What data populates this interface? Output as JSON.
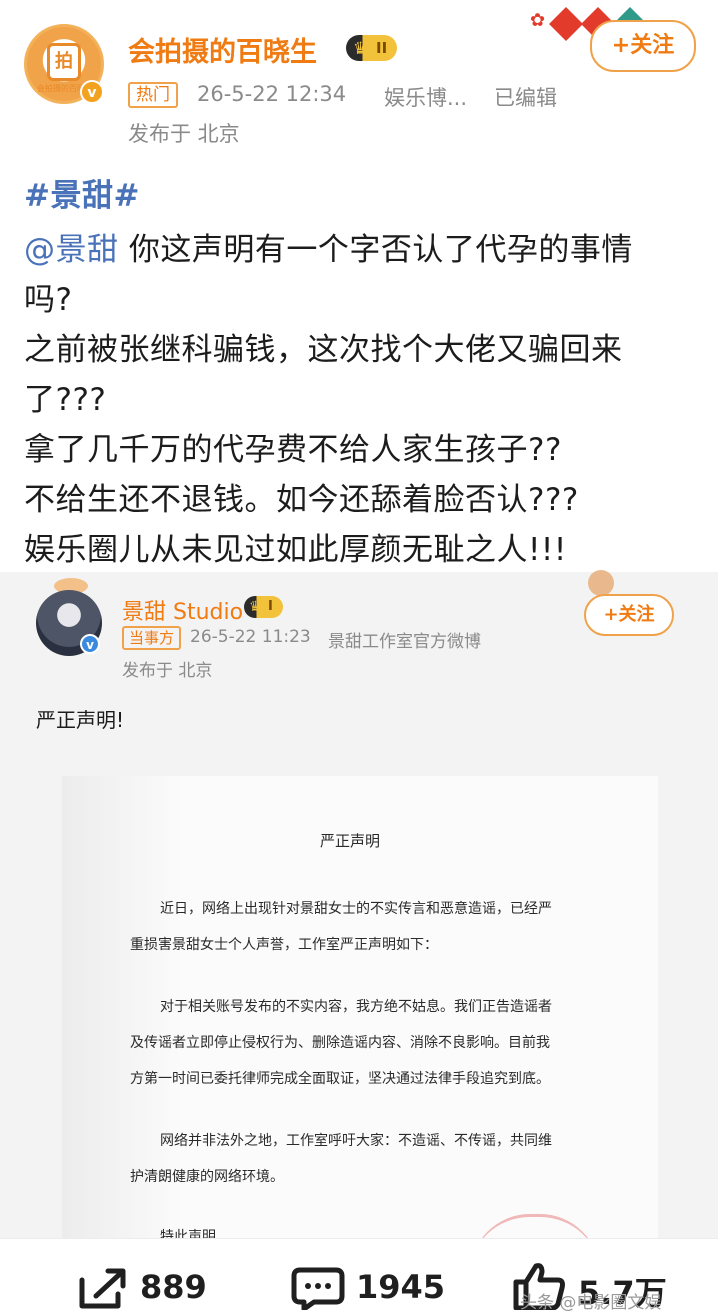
{
  "post": {
    "author": "会拍摄的百晓生",
    "level_badge": "II",
    "follow_label": "+关注",
    "hot_tag": "热门",
    "timestamp": "26-5-22 12:34",
    "source": "娱乐博...",
    "edited": "已编辑",
    "location": "发布于 北京",
    "avatar_caption": "会拍摄的百晓生",
    "hashtag": "#景甜#",
    "mention": "@景甜",
    "lines": [
      "你这声明有一个字否认了代孕的事情",
      "吗?",
      "之前被张继科骗钱，这次找个大佬又骗回来",
      "了???",
      "拿了几千万的代孕费不给人家生孩子??",
      "不给生还不退钱。如今还舔着脸否认???",
      "娱乐圈儿从未见过如此厚颜无耻之人!!!"
    ]
  },
  "repost": {
    "author": "景甜 Studio",
    "level_badge": "I",
    "follow_label": "+关注",
    "party_tag": "当事方",
    "timestamp": "26-5-22 11:23",
    "source": "景甜工作室官方微博",
    "location": "发布于 北京",
    "text": "严正声明!",
    "document": {
      "title": "严正声明",
      "lines": [
        "近日，网络上出现针对景甜女士的不实传言和恶意造谣，已经严",
        "重损害景甜女士个人声誉，工作室严正声明如下：",
        "对于相关账号发布的不实内容，我方绝不姑息。我们正告造谣者",
        "及传谣者立即停止侵权行为、删除造谣内容、消除不良影响。目前我",
        "方第一时间已委托律师完成全面取证，坚决通过法律手段追究到底。",
        "网络并非法外之地，工作室呼吁大家：不造谣、不传谣，共同维",
        "护清朗健康的网络环境。",
        "特此声明"
      ]
    }
  },
  "actions": {
    "share_count": "889",
    "comment_count": "1945",
    "like_count": "5.7万"
  },
  "watermark": "头条 @电影圈文娱",
  "colors": {
    "accent": "#f07b12",
    "link": "#4a72b8",
    "card_bg": "#f3f3f3"
  }
}
